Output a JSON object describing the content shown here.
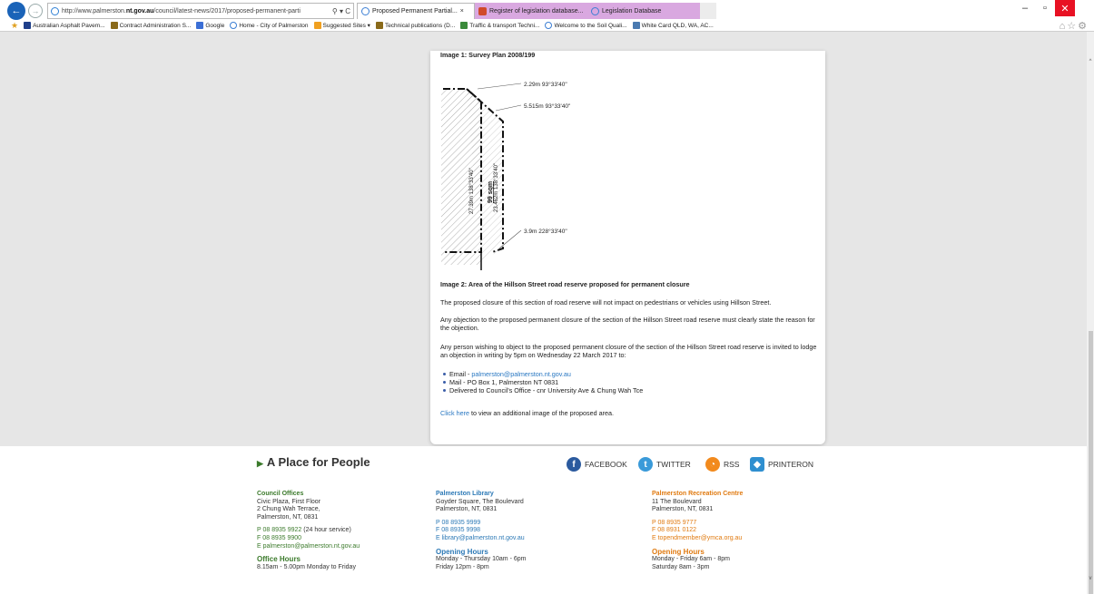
{
  "browser": {
    "address_prefix": "http://www.palmerston.",
    "address_domain": "nt.gov.au",
    "address_path": "/council/latest-news/2017/proposed-permanent-parti",
    "address_tools": "⚲ ▾ C",
    "tabs": [
      {
        "label": "Proposed Permanent Partial...",
        "close": "×",
        "color": "#3c7fd4"
      },
      {
        "label": "Register of legislation database...",
        "color": "#d04a2a"
      },
      {
        "label": "Legislation Database",
        "color": "#3c7fd4"
      }
    ],
    "favorites": [
      {
        "label": "Australian Asphalt Pavem...",
        "color": "#1f3f8a"
      },
      {
        "label": "Contract Administration S...",
        "color": "#8a6a1a"
      },
      {
        "label": "Google",
        "color": "#3b6fd6"
      },
      {
        "label": "Home - City of Palmerston",
        "color": "#3c7fd4"
      },
      {
        "label": "Suggested Sites ▾",
        "color": "#f0a020"
      },
      {
        "label": "Technical publications (D...",
        "color": "#8a6a1a"
      },
      {
        "label": "Traffic & transport Techni...",
        "color": "#3a8a3a"
      },
      {
        "label": "Welcome to the Soil Quali...",
        "color": "#3c7fd4"
      },
      {
        "label": "White Card QLD, WA, AC...",
        "color": "#4a7ab0"
      }
    ]
  },
  "article": {
    "image1_caption": "Image 1: Survey Plan 2008/199",
    "plan": {
      "label_top": "2.29m 93°33'40\"",
      "label_mid": "5.515m 93°33'40\"",
      "label_bottom": "3.9m 228°33'40\"",
      "label_left_vertical": "27.39m 138°33'40\"",
      "label_area": "99 sqm",
      "label_right_vertical": "23.462m 138°33'40\""
    },
    "image2_caption": "Image 2: Area of the Hillson Street road reserve proposed for permanent closure",
    "para1": "The proposed closure of this section of road reserve will not impact on pedestrians or vehicles using Hillson Street.",
    "para2": "Any objection to the proposed permanent closure of the section of the Hillson Street road reserve must clearly state the reason for the objection.",
    "para3": "Any person wishing to object to the proposed permanent closure of the section of the Hillson Street road reserve is invited to lodge an objection in writing by 5pm on Wednesday 22 March 2017 to:",
    "bullets": {
      "email_prefix": "Email - ",
      "email": "palmerston@palmerston.nt.gov.au",
      "mail": "Mail - PO Box 1, Palmerston NT 0831",
      "delivered": "Delivered to Council's Office - cnr University Ave & Chung Wah Tce"
    },
    "click_here": "Click here",
    "click_rest": " to view an additional image of the proposed area."
  },
  "footer": {
    "tagline": "A Place for People",
    "social": {
      "facebook": "FACEBOOK",
      "twitter": "TWITTER",
      "rss": "RSS",
      "printeron": "PRINTERON"
    },
    "council": {
      "title": "Council Offices",
      "line1": "Civic Plaza, First Floor",
      "line2": "2 Chung Wah Terrace,",
      "line3": "Palmerston, NT, 0831",
      "phone_prefix": "P 08 8935 9922",
      "phone_suffix": " (24 hour service)",
      "fax": "F 08 8935 9900",
      "email": "E palmerston@palmerston.nt.gov.au",
      "hours_title": "Office Hours",
      "hours": "8.15am - 5.00pm Monday to Friday"
    },
    "library": {
      "title": "Palmerston Library",
      "line1": "Goyder Square, The Boulevard",
      "line2": "Palmerston, NT, 0831",
      "phone": "P 08 8935 9999",
      "fax": "F 08 8935 9998",
      "email": "E library@palmerston.nt.gov.au",
      "hours_title": "Opening Hours",
      "hours1": "Monday - Thursday 10am - 6pm",
      "hours2": "Friday 12pm - 8pm"
    },
    "recreation": {
      "title": "Palmerston Recreation Centre",
      "line1": "11 The Boulevard",
      "line2": "Palmerston, NT, 0831",
      "phone": "P 08 8935 9777",
      "fax": "F 08 8931 0122",
      "email": "E topendmember@ymca.org.au",
      "hours_title": "Opening Hours",
      "hours1": "Monday - Friday 6am - 8pm",
      "hours2": "Saturday 8am - 3pm"
    }
  }
}
